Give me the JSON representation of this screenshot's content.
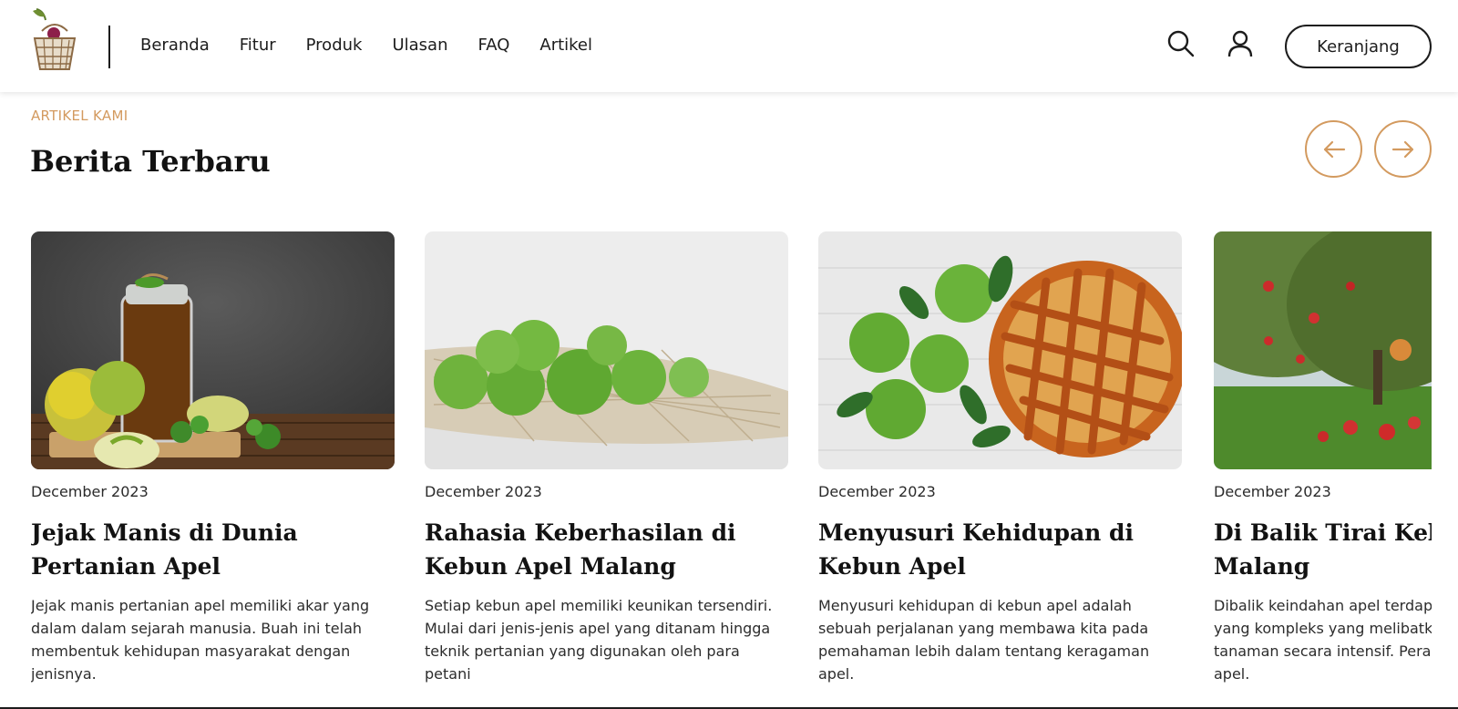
{
  "header": {
    "logo_icon": "apple-basket-logo",
    "nav": [
      "Beranda",
      "Fitur",
      "Produk",
      "Ulasan",
      "FAQ",
      "Artikel"
    ],
    "search_icon": "search-icon",
    "user_icon": "user-icon",
    "cart_label": "Keranjang"
  },
  "section": {
    "eyebrow": "ARTIKEL KAMI",
    "title": "Berita Terbaru",
    "prev_icon": "arrow-left-icon",
    "next_icon": "arrow-right-icon",
    "accent_color": "#d39a5f"
  },
  "articles": [
    {
      "date": "December 2023",
      "title": "Jejak Manis di Dunia Pertanian Apel",
      "excerpt": "Jejak manis pertanian apel memiliki akar yang dalam dalam sejarah manusia. Buah ini telah membentuk kehidupan masyarakat dengan jenisnya.",
      "image": "apple-juice-jar-photo"
    },
    {
      "date": "December 2023",
      "title": "Rahasia Keberhasilan di Kebun Apel Malang",
      "excerpt": "Setiap kebun apel memiliki keunikan tersendiri. Mulai dari jenis-jenis apel yang ditanam hingga teknik pertanian yang digunakan oleh para petani",
      "image": "green-apples-net-bag-photo"
    },
    {
      "date": "December 2023",
      "title": "Menyusuri Kehidupan di Kebun Apel",
      "excerpt": "Menyusuri kehidupan di kebun apel adalah sebuah perjalanan yang membawa kita pada pemahaman lebih dalam tentang keragaman apel.",
      "image": "apple-pie-photo"
    },
    {
      "date": "December 2023",
      "title": "Di Balik Tirai Kebun Malang",
      "excerpt_lines": [
        "Dibalik keindahan apel terdapo",
        "yang kompleks yang melibatka",
        "tanaman secara intensif. Peran",
        "apel."
      ],
      "image": "apple-orchard-photo"
    }
  ]
}
